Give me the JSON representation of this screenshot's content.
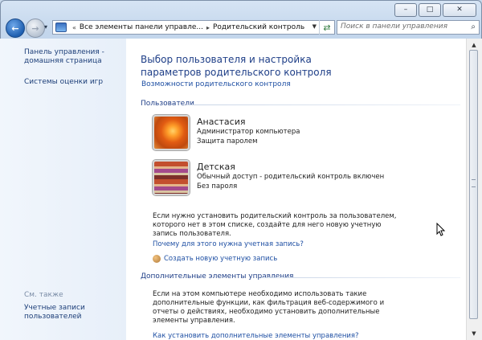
{
  "window": {
    "minimize_glyph": "–",
    "maximize_glyph": "□",
    "close_glyph": "✕"
  },
  "nav": {
    "back_glyph": "←",
    "forward_glyph": "→",
    "history_glyph": "▾",
    "address_sep": "«",
    "breadcrumb_1": "Все элементы панели управле...",
    "breadcrumb_arrow": "▸",
    "breadcrumb_2": "Родительский контроль",
    "address_drop_glyph": "▼",
    "refresh_glyph": "⇄",
    "search_placeholder": "Поиск в панели управления",
    "search_icon_glyph": "⌕"
  },
  "left_pane": {
    "home_link": "Панель управления - домашняя страница",
    "ratings_link": "Системы оценки игр",
    "see_also": "См. также",
    "accounts_link": "Учетные записи пользователей"
  },
  "main": {
    "help_glyph": "?",
    "title": "Выбор пользователя и настройка параметров родительского контроля",
    "features_link": "Возможности родительского контроля",
    "users_header": "Пользователи",
    "users": [
      {
        "name": "Анастасия",
        "line1": "Администратор компьютера",
        "line2": "Защита паролем"
      },
      {
        "name": "Детская",
        "line1": "Обычный доступ - родительский контроль включен",
        "line2": "Без пароля"
      }
    ],
    "info_text": "Если нужно установить родительский контроль за пользователем, которого нет в этом списке, создайте для него новую учетную запись пользователя.",
    "why_link": "Почему для этого нужна учетная запись?",
    "create_link": "Создать новую учетную запись",
    "extra_header": "Дополнительные элементы управления",
    "extra_text": "Если на этом компьютере необходимо использовать такие дополнительные функции, как фильтрация веб-содержимого и отчеты о действиях, необходимо установить дополнительные элементы управления.",
    "cut_link": "Как установить дополнительные элементы управления?"
  },
  "scrollbar": {
    "up_glyph": "▲",
    "down_glyph": "▼"
  },
  "colors": {
    "link": "#1e4fa3",
    "heading": "#1e3e87",
    "left_pane_bg": "#e9f1fa",
    "frame": "#c3d6ec"
  },
  "icons": [
    "back-arrow-icon",
    "forward-arrow-icon",
    "control-panel-icon",
    "refresh-icon",
    "search-icon",
    "help-icon",
    "user-add-icon"
  ]
}
